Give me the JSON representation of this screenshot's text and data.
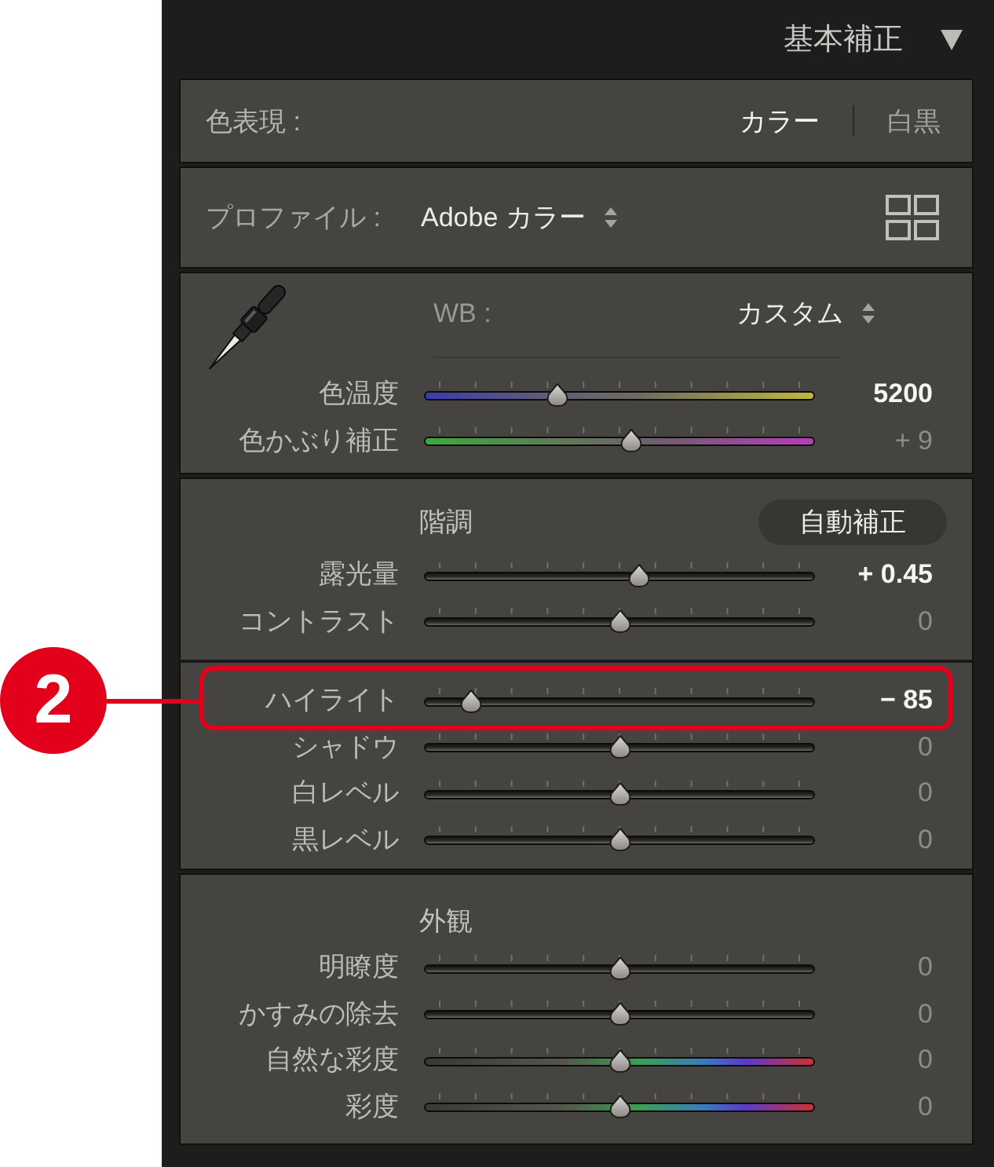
{
  "panel": {
    "title": "基本補正",
    "expanded": true
  },
  "treatment": {
    "label": "色表現 :",
    "options": [
      {
        "label": "カラー",
        "selected": true
      },
      {
        "label": "白黒",
        "selected": false
      }
    ]
  },
  "profile": {
    "label": "プロファイル :",
    "value": "Adobe カラー"
  },
  "white_balance": {
    "label": "WB :",
    "value": "カスタム",
    "sliders": [
      {
        "label": "色温度",
        "kind": "temperature",
        "level": 0.34,
        "value": "5200",
        "active": true
      },
      {
        "label": "色かぶり補正",
        "kind": "tint",
        "level": 0.53,
        "value": "+ 9",
        "active": false
      }
    ]
  },
  "tone": {
    "title": "階調",
    "auto_button": "自動補正",
    "groups": [
      {
        "sliders": [
          {
            "label": "露光量",
            "kind": "neutral",
            "level": 0.55,
            "value": "+ 0.45",
            "active": true
          },
          {
            "label": "コントラスト",
            "kind": "neutral",
            "level": 0.5,
            "value": "0",
            "active": false
          }
        ]
      },
      {
        "sliders": [
          {
            "label": "ハイライト",
            "kind": "neutral",
            "level": 0.12,
            "value": "− 85",
            "active": true,
            "callout": "2"
          },
          {
            "label": "シャドウ",
            "kind": "neutral",
            "level": 0.5,
            "value": "0",
            "active": false
          },
          {
            "label": "白レベル",
            "kind": "neutral",
            "level": 0.5,
            "value": "0",
            "active": false
          },
          {
            "label": "黒レベル",
            "kind": "neutral",
            "level": 0.5,
            "value": "0",
            "active": false
          }
        ]
      }
    ]
  },
  "presence": {
    "title": "外観",
    "sliders": [
      {
        "label": "明瞭度",
        "kind": "neutral",
        "level": 0.5,
        "value": "0",
        "active": false
      },
      {
        "label": "かすみの除去",
        "kind": "neutral",
        "level": 0.5,
        "value": "0",
        "active": false
      },
      {
        "label": "自然な彩度",
        "kind": "saturation",
        "level": 0.5,
        "value": "0",
        "active": false
      },
      {
        "label": "彩度",
        "kind": "saturation",
        "level": 0.5,
        "value": "0",
        "active": false
      }
    ]
  }
}
